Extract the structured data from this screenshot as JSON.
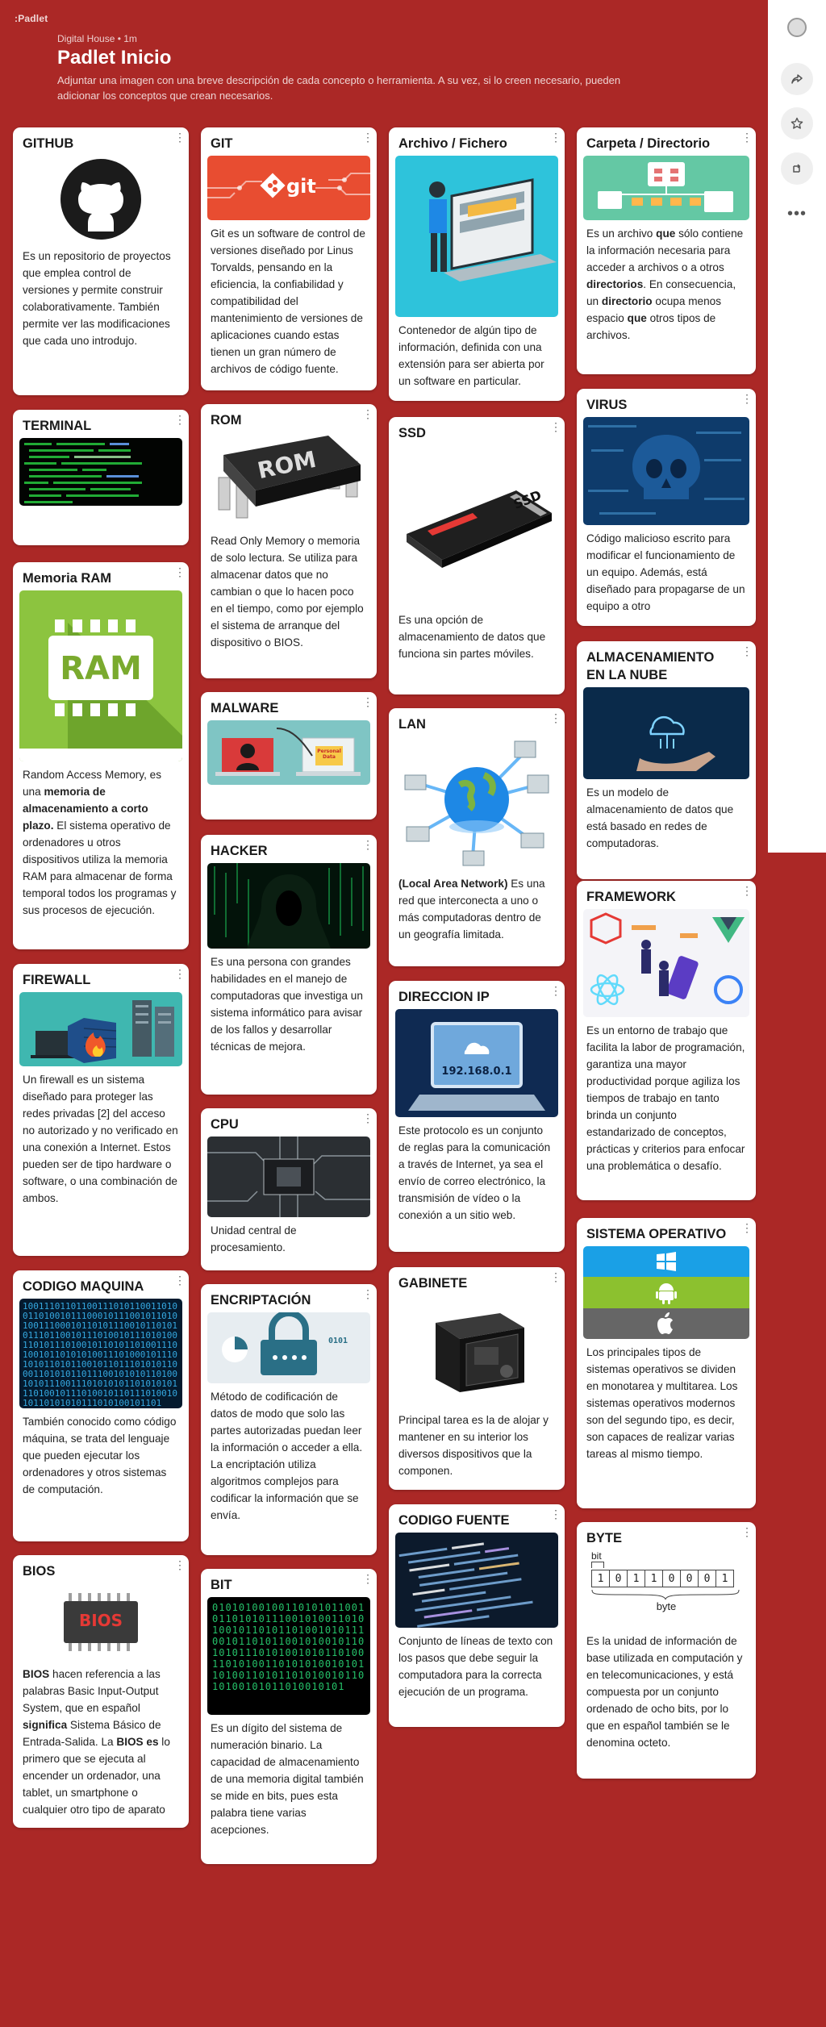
{
  "app": {
    "brand": ":Padlet",
    "meta": "Digital House • 1m",
    "title": "Padlet Inicio",
    "description": "Adjuntar una imagen con una breve descripción de cada concepto o herramienta. A su vez, si lo creen necesario, pueden adicionar los conceptos que crean necesarios."
  },
  "rail": {
    "icons": [
      "avatar",
      "share-icon",
      "star-icon",
      "remix-icon",
      "more-icon"
    ]
  },
  "colors": {
    "background": "#ab2826",
    "card": "#ffffff"
  },
  "cards": {
    "github": {
      "title": "GITHUB",
      "text": "Es un repositorio de proyectos que emplea control de versiones y permite construir colaborativamente. También permite ver las modificaciones que cada uno introdujo."
    },
    "terminal": {
      "title": "TERMINAL"
    },
    "ram": {
      "title": "Memoria RAM",
      "img_label": "RAM",
      "t1": "Random Access Memory, es una ",
      "b1": "memoria de almacenamiento a corto plazo.",
      "t2": " El sistema operativo de ordenadores u otros dispositivos utiliza la memoria RAM para almacenar de forma temporal todos los programas y sus procesos de ejecución."
    },
    "firewall": {
      "title": "FIREWALL",
      "text": "Un firewall es un sistema diseñado para proteger las redes privadas [2] del acceso no autorizado y no verificado en una conexión a Internet. Estos pueden ser de tipo hardware o software, o una combinación de ambos."
    },
    "codigo_maquina": {
      "title": "CODIGO MAQUINA",
      "text": "También conocido como código máquina, se trata del lenguaje que pueden ejecutar los ordenadores y otros sistemas de computación."
    },
    "bios": {
      "title": "BIOS",
      "img_label": "BIOS",
      "b1": "BIOS",
      "t1": " hacen referencia a las palabras Basic Input-Output System, que en español ",
      "b2": "significa",
      "t2": " Sistema Básico de Entrada-Salida. La ",
      "b3": "BIOS es",
      "t3": " lo primero que se ejecuta al encender un ordenador, una tablet, un smartphone o cualquier otro tipo de aparato"
    },
    "git": {
      "title": "GIT",
      "img_label": "git",
      "text": "Git es un software de control de versiones diseñado por Linus Torvalds, pensando en la eficiencia, la confiabilidad y compatibilidad del mantenimiento de versiones de aplicaciones cuando estas tienen un gran número de archivos de código fuente."
    },
    "rom": {
      "title": "ROM",
      "img_label": "ROM",
      "text": "Read Only Memory o memoria de solo lectura.  Se utiliza para almacenar datos que no cambian o que lo hacen poco en el tiempo, como por ejemplo el sistema de arranque del dispositivo o BIOS."
    },
    "malware": {
      "title": "MALWARE",
      "img_label": "Personal\nData"
    },
    "hacker": {
      "title": "HACKER",
      "text": "Es una persona con grandes habilidades en el manejo de computadoras que investiga un sistema informático para avisar de los fallos y desarrollar técnicas de mejora."
    },
    "cpu": {
      "title": "CPU",
      "text": "Unidad central de procesamiento."
    },
    "encriptacion": {
      "title": "ENCRIPTACIÓN",
      "img_label": "0101",
      "text": "Método de codificación de datos de modo que solo las partes autorizadas puedan leer la información o acceder a ella. La encriptación utiliza algoritmos complejos para codificar la información que se envía."
    },
    "bit": {
      "title": "BIT",
      "text": "Es un dígito del sistema de numeración binario. La capacidad de almacenamiento de una memoria digital también se mide en bits, pues esta palabra tiene varias acepciones."
    },
    "archivo": {
      "title": "Archivo / Fichero",
      "text": "Contenedor de algún tipo de información, definida con una extensión para ser abierta por un software en particular."
    },
    "ssd": {
      "title": "SSD",
      "img_label": "SSD",
      "text": "Es una opción de almacenamiento de datos que funciona sin partes móviles."
    },
    "lan": {
      "title": "LAN",
      "b1": "(Local Area Network)",
      "t1": " Es una red que interconecta a uno o más computadoras dentro de un geografía limitada."
    },
    "ip": {
      "title": "DIRECCION IP",
      "img_label": "192.168.0.1",
      "text": "Este protocolo es un conjunto de reglas para la comunicación a través de Internet, ya sea el envío de correo electrónico, la transmisión de vídeo o la conexión a un sitio web."
    },
    "gabinete": {
      "title": "GABINETE",
      "text": "Principal tarea es la de alojar y mantener en su interior los diversos dispositivos que la componen."
    },
    "codigo_fuente": {
      "title": "CODIGO FUENTE",
      "text": "Conjunto de líneas de texto con los pasos que debe seguir la computadora para la correcta ejecución de un programa."
    },
    "carpeta": {
      "title": "Carpeta / Directorio",
      "t1": "Es un archivo ",
      "b1": "que",
      "t2": " sólo contiene la información necesaria para acceder a archivos o a otros ",
      "b2": "directorios",
      "t3": ". En consecuencia, un ",
      "b3": "directorio",
      "t4": " ocupa menos espacio ",
      "b4": "que",
      "t5": " otros tipos de archivos."
    },
    "virus": {
      "title": "VIRUS",
      "text": "Código malicioso escrito para modificar el funcionamiento de un equipo. Además, está diseñado para propagarse de un equipo a otro"
    },
    "nube": {
      "title": "ALMACENAMIENTO EN LA NUBE",
      "text": "Es un modelo de almacenamiento de datos que está basado en redes de computadoras."
    },
    "framework": {
      "title": "FRAMEWORK",
      "text": "Es un entorno de trabajo que facilita la labor de programación, garantiza una mayor productividad porque agiliza los tiempos de trabajo en tanto brinda un conjunto estandarizado de conceptos, prácticas y criterios para enfocar una problemática o desafío."
    },
    "so": {
      "title": "SISTEMA OPERATIVO",
      "text": "Los principales tipos de sistemas operativos se dividen en monotarea y multitarea. Los sistemas operativos modernos son del segundo tipo, es decir, son capaces de realizar varias tareas al mismo tiempo."
    },
    "byte": {
      "title": "BYTE",
      "bit_label": "bit",
      "bits": [
        "1",
        "0",
        "1",
        "1",
        "0",
        "0",
        "0",
        "1"
      ],
      "byte_label": "byte",
      "text": "Es la unidad de información de base utilizada en computación y en telecomunicaciones, y está compuesta por un conjunto ordenado de ocho bits,  por lo que en español también se le denomina octeto."
    }
  }
}
